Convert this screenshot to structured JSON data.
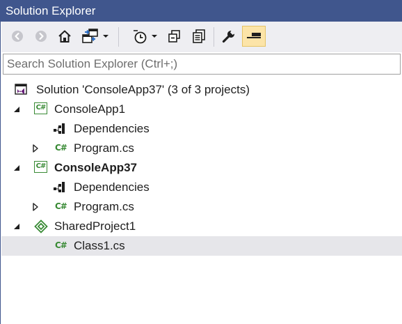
{
  "window": {
    "title": "Solution Explorer"
  },
  "toolbar": {
    "buttons": [
      {
        "name": "back-button",
        "icon": "arrow-left-circle-icon",
        "enabled": false
      },
      {
        "name": "forward-button",
        "icon": "arrow-right-circle-icon",
        "enabled": false
      },
      {
        "name": "home-button",
        "icon": "home-icon",
        "enabled": true
      },
      {
        "name": "switch-views-button",
        "icon": "switch-views-icon",
        "enabled": true
      },
      {
        "name": "pending-changes-filter-button",
        "icon": "clock-icon",
        "enabled": true
      },
      {
        "name": "collapse-all-button",
        "icon": "collapse-all-icon",
        "enabled": true
      },
      {
        "name": "show-all-files-button",
        "icon": "copy-files-icon",
        "enabled": true
      },
      {
        "name": "properties-button",
        "icon": "wrench-icon",
        "enabled": true
      },
      {
        "name": "preview-selected-button",
        "icon": "preview-icon",
        "enabled": true,
        "active": true
      }
    ]
  },
  "search": {
    "placeholder": "Search Solution Explorer (Ctrl+;)",
    "value": ""
  },
  "tree": {
    "solution": {
      "label": "Solution 'ConsoleApp37' (3 of 3 projects)",
      "icon": "visual-studio-solution-icon"
    },
    "projects": [
      {
        "label": "ConsoleApp1",
        "icon": "csharp-project-icon",
        "expanded": true,
        "bold": false,
        "children": [
          {
            "label": "Dependencies",
            "icon": "dependencies-icon",
            "expandable": false
          },
          {
            "label": "Program.cs",
            "icon": "csharp-file-icon",
            "expandable": true
          }
        ]
      },
      {
        "label": "ConsoleApp37",
        "icon": "csharp-project-icon",
        "expanded": true,
        "bold": true,
        "children": [
          {
            "label": "Dependencies",
            "icon": "dependencies-icon",
            "expandable": false
          },
          {
            "label": "Program.cs",
            "icon": "csharp-file-icon",
            "expandable": true
          }
        ]
      },
      {
        "label": "SharedProject1",
        "icon": "shared-project-icon",
        "expanded": true,
        "bold": false,
        "children": [
          {
            "label": "Class1.cs",
            "icon": "csharp-file-icon",
            "expandable": false,
            "selected": true
          }
        ]
      }
    ]
  },
  "colors": {
    "title_bar": "#40568d",
    "toolbar_bg": "#eeeef2",
    "selection_bg": "#e6e6ea",
    "csharp_green": "#388a34",
    "vs_purple": "#68217a"
  }
}
